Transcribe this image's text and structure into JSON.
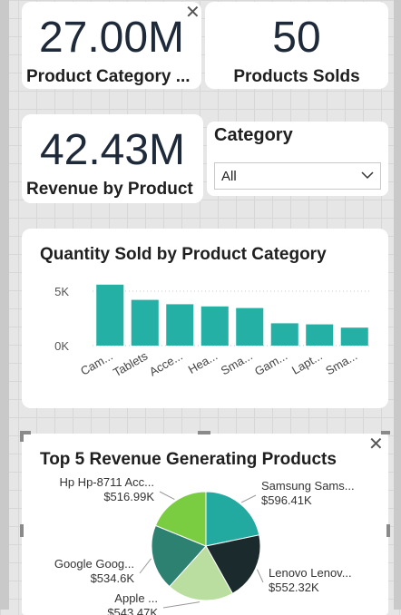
{
  "kpi_cards": [
    {
      "value": "27.00M",
      "label": "Product Category ..."
    },
    {
      "value": "50",
      "label": "Products Solds"
    },
    {
      "value": "42.43M",
      "label": "Revenue by Product"
    }
  ],
  "slicer": {
    "title": "Category",
    "selected": "All"
  },
  "icons": {
    "close": "close-icon",
    "dropdown": "chevron-down-icon"
  },
  "colors": {
    "bar": "#24b0a5",
    "title_text": "#1e2a3a"
  },
  "bar_chart": {
    "chart_data": {
      "type": "bar",
      "title": "Quantity Sold by Product Category",
      "categories": [
        "Cam...",
        "Tablets",
        "Acce...",
        "Hea...",
        "Sma...",
        "Gam...",
        "Lapt...",
        "Sma..."
      ],
      "values": [
        5600,
        4200,
        3800,
        3600,
        3450,
        2050,
        1950,
        1650
      ],
      "y_ticks": [
        "5K",
        "0K"
      ],
      "ylim": [
        0,
        7000
      ],
      "grid": true
    }
  },
  "pie_chart": {
    "chart_data": {
      "type": "pie",
      "title": "Top 5 Revenue Generating Products",
      "slices": [
        {
          "name": "Samsung Sams...",
          "label": "$596.41K",
          "value": 596.41,
          "color": "#22aaa0"
        },
        {
          "name": "Lenovo Lenov...",
          "label": "$552.32K",
          "value": 552.32,
          "color": "#1b2a2c"
        },
        {
          "name": "Apple ...",
          "label": "$543.47K",
          "value": 543.47,
          "color": "#b9dea0"
        },
        {
          "name": "Google Goog...",
          "label": "$534.6K",
          "value": 534.6,
          "color": "#2c8170"
        },
        {
          "name": "Hp Hp-8711 Acc...",
          "label": "$516.99K",
          "value": 516.99,
          "color": "#7acc40"
        }
      ]
    }
  }
}
